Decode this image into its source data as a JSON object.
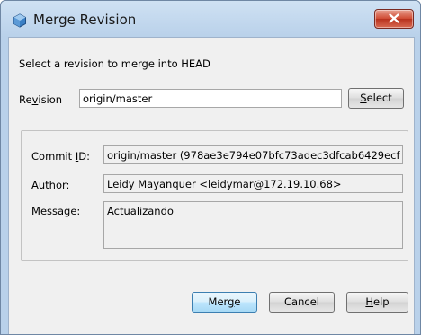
{
  "window": {
    "title": "Merge Revision",
    "icon": "netbeans-cube-icon",
    "close_icon": "close-x-icon",
    "close_color": "#c9402a"
  },
  "prompt": "Select a revision to merge into HEAD",
  "revision": {
    "label_pre": "Re",
    "label_mnemonic": "v",
    "label_post": "ision",
    "value": "origin/master",
    "select_label_mnemonic": "S",
    "select_label_rest": "elect"
  },
  "details": {
    "commit_label_pre": "Commit ",
    "commit_label_mnemonic": "I",
    "commit_label_post": "D:",
    "commit_value": "origin/master (978ae3e794e07bfc73adec3dfcab6429ecf",
    "author_label_mnemonic": "A",
    "author_label_rest": "uthor:",
    "author_value": "Leidy Mayanquer <leidymar@172.19.10.68>",
    "message_label_mnemonic": "M",
    "message_label_rest": "essage:",
    "message_value": "Actualizando"
  },
  "buttons": {
    "merge_pre": "Mer",
    "merge_mnemonic": "g",
    "merge_post": "e",
    "cancel": "Cancel",
    "help_mnemonic": "H",
    "help_rest": "elp"
  }
}
